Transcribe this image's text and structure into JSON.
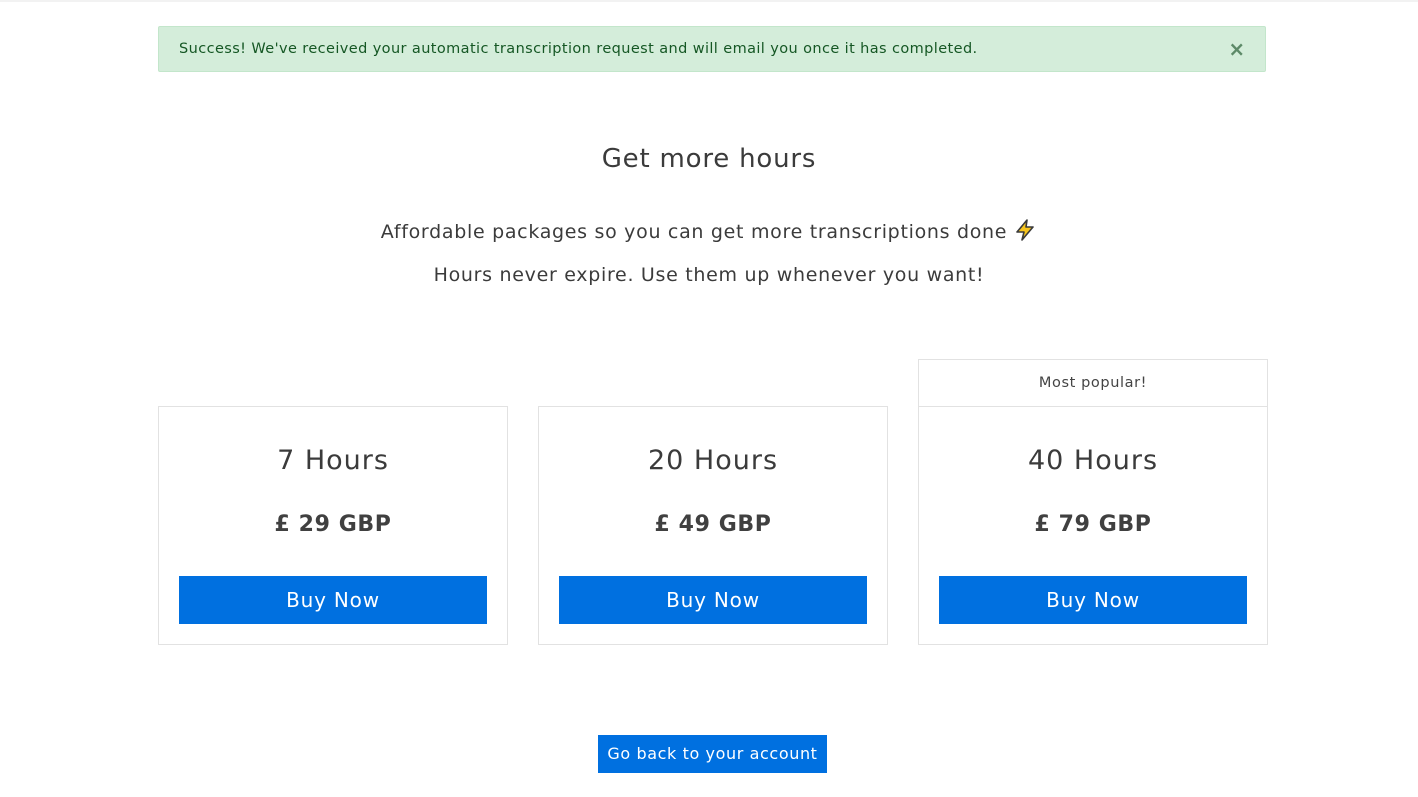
{
  "alert": {
    "message": "Success! We've received your automatic transcription request and will email you once it has completed.",
    "close_icon": "×",
    "background_color": "#d4edda",
    "text_color": "#155724"
  },
  "header": {
    "title": "Get more hours",
    "subtitle_line1": "Affordable packages so you can get more transcriptions done",
    "subtitle_icon": "lightning-bolt-icon",
    "subtitle_line2": "Hours never expire. Use them up whenever you want!"
  },
  "packages": [
    {
      "hours": "7 Hours",
      "price": "£ 29 GBP",
      "button_label": "Buy Now",
      "badge": ""
    },
    {
      "hours": "20 Hours",
      "price": "£ 49 GBP",
      "button_label": "Buy Now",
      "badge": ""
    },
    {
      "hours": "40 Hours",
      "price": "£ 79 GBP",
      "button_label": "Buy Now",
      "badge": "Most popular!"
    }
  ],
  "footer": {
    "back_button_label": "Go back to your account"
  },
  "colors": {
    "primary": "#0070e0",
    "card_border": "#e2e2e2"
  }
}
